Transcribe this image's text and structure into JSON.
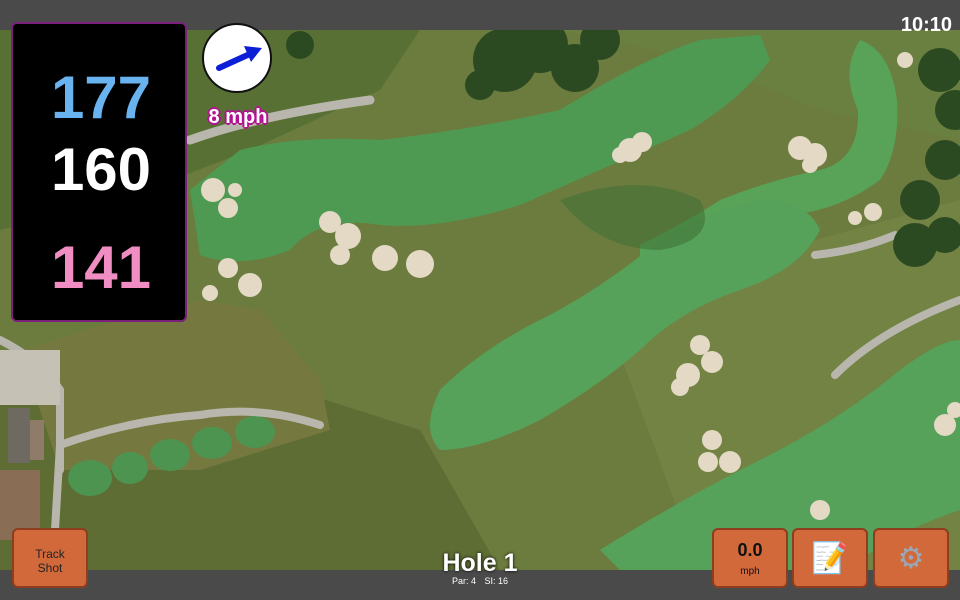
{
  "status_bar": {
    "time": "10:10"
  },
  "distances": {
    "back": "177",
    "middle": "160",
    "front": "141"
  },
  "wind": {
    "speed": "8 mph",
    "direction_icon": "arrow-right-up-icon",
    "arrow_color": "#0b1fd6"
  },
  "buttons": {
    "track_shot": {
      "line1": "Track",
      "line2": "Shot"
    },
    "speed": {
      "value": "0.0",
      "unit": "mph"
    },
    "notes_icon": "notepad-icon",
    "settings_icon": "gear-icon"
  },
  "hole": {
    "title": "Hole 1",
    "par": "Par: 4",
    "si": "SI: 16"
  },
  "colors": {
    "back_distance": "#69b4f0",
    "middle_distance": "#ffffff",
    "front_distance": "#f08ec3",
    "button_bg": "#d2693b",
    "panel_border": "#7a1f7a",
    "wind_outline": "#b1128f"
  }
}
